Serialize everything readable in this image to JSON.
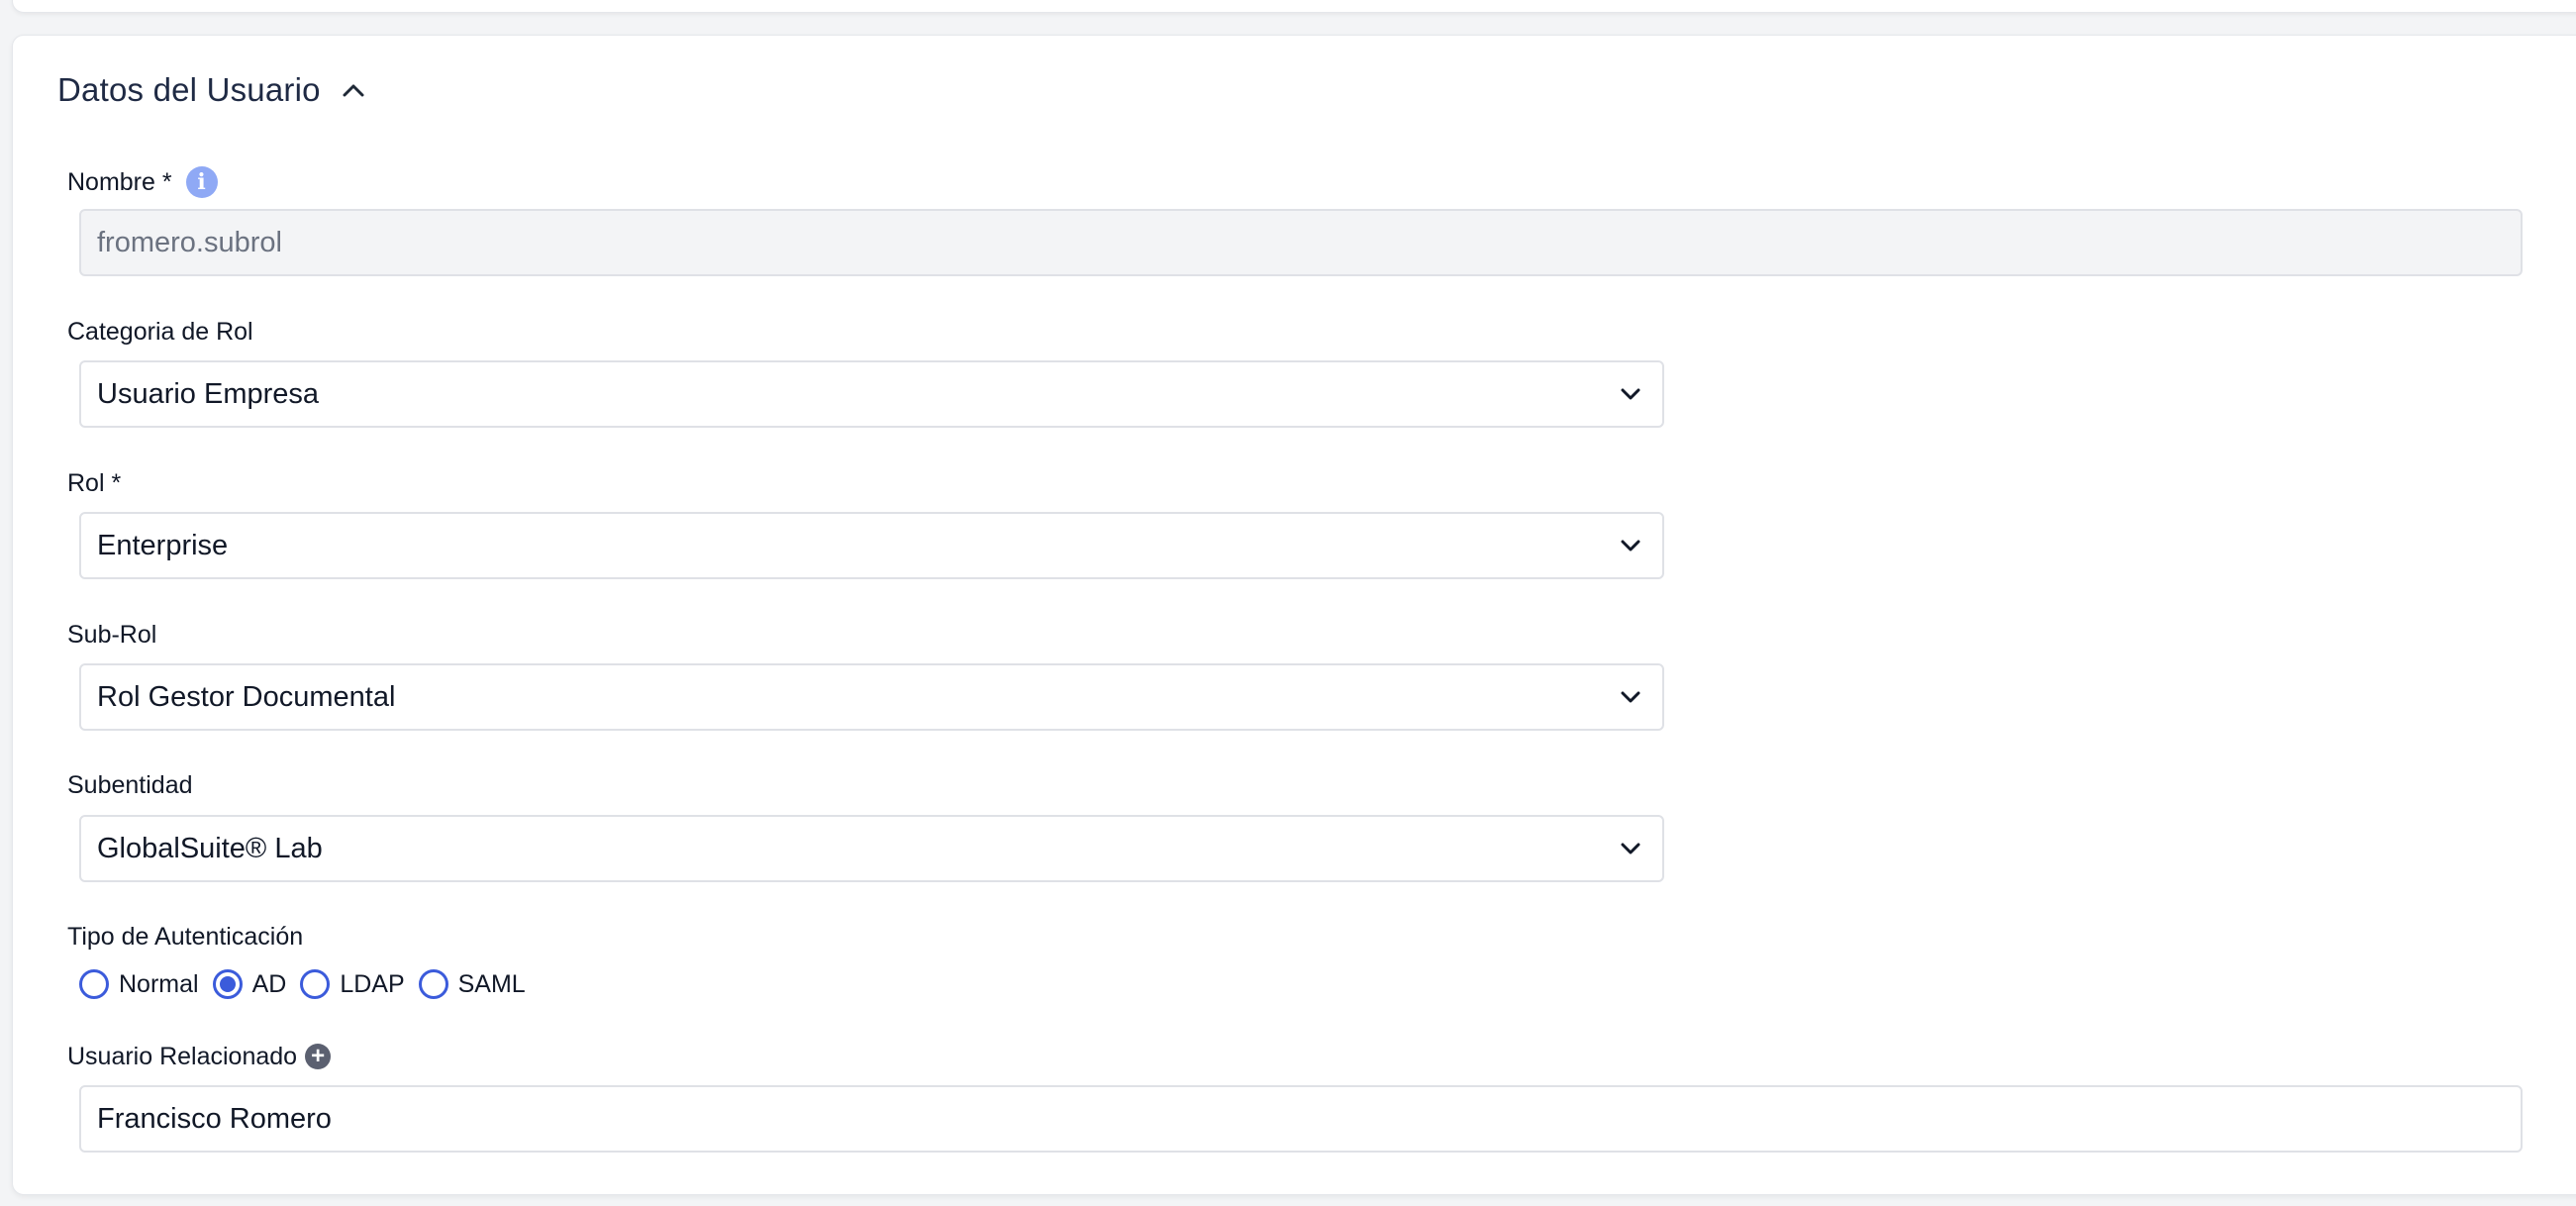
{
  "section": {
    "title": "Datos del Usuario",
    "expanded": true
  },
  "fields": {
    "nombre": {
      "label": "Nombre *",
      "value": "fromero.subrol"
    },
    "categoria": {
      "label": "Categoria de Rol",
      "value": "Usuario Empresa"
    },
    "rol": {
      "label": "Rol *",
      "value": "Enterprise"
    },
    "subrol": {
      "label": "Sub-Rol",
      "value": "Rol Gestor Documental"
    },
    "subentidad": {
      "label": "Subentidad",
      "value": "GlobalSuite® Lab"
    },
    "auth": {
      "label": "Tipo de Autenticación",
      "options": [
        "Normal",
        "AD",
        "LDAP",
        "SAML"
      ],
      "selected": "AD"
    },
    "relacionado": {
      "label": "Usuario Relacionado",
      "value": "Francisco Romero"
    }
  },
  "icons": {
    "info": "info-icon",
    "add": "plus-circle-icon",
    "dropdown": "chevron-down-icon",
    "collapse": "chevron-up-icon"
  },
  "colors": {
    "accent": "#3b5bdb",
    "info": "#8fa9f5",
    "border": "#dfe1e6",
    "disabled_bg": "#f3f4f6"
  }
}
